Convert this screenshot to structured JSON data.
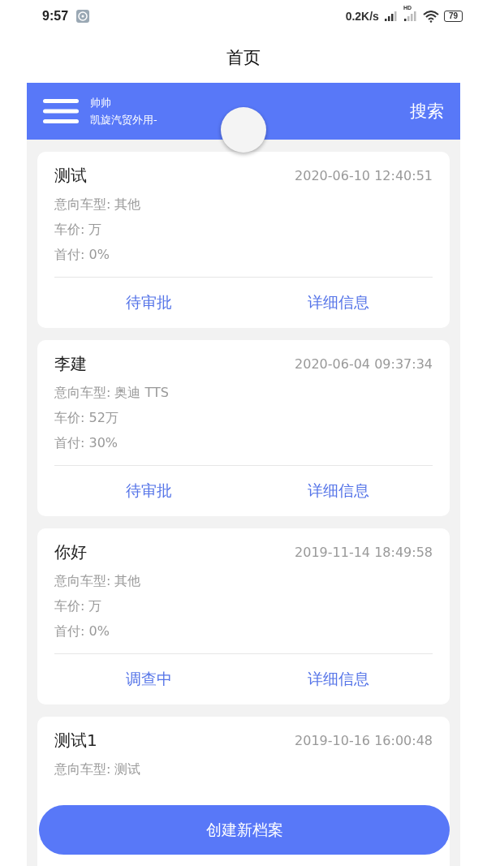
{
  "status_bar": {
    "time": "9:57",
    "speed": "0.2K/s",
    "network": "HD",
    "battery": "79"
  },
  "title": "首页",
  "header": {
    "user_name": "帅帅",
    "company": "凯旋汽贸外用-",
    "search": "搜索"
  },
  "cards": [
    {
      "name": "测试",
      "time": "2020-06-10 12:40:51",
      "details": [
        "意向车型: 其他",
        "车价: 万",
        "首付: 0%"
      ],
      "actions": [
        "待审批",
        "详细信息"
      ]
    },
    {
      "name": "李建",
      "time": "2020-06-04 09:37:34",
      "details": [
        "意向车型: 奥迪 TTS",
        "车价: 52万",
        "首付: 30%"
      ],
      "actions": [
        "待审批",
        "详细信息"
      ]
    },
    {
      "name": "你好",
      "time": "2019-11-14 18:49:58",
      "details": [
        "意向车型: 其他",
        "车价: 万",
        "首付: 0%"
      ],
      "actions": [
        "调查中",
        "详细信息"
      ]
    },
    {
      "name": "测试1",
      "time": "2019-10-16 16:00:48",
      "details": [
        "意向车型: 测试"
      ]
    }
  ],
  "create_button": "创建新档案"
}
